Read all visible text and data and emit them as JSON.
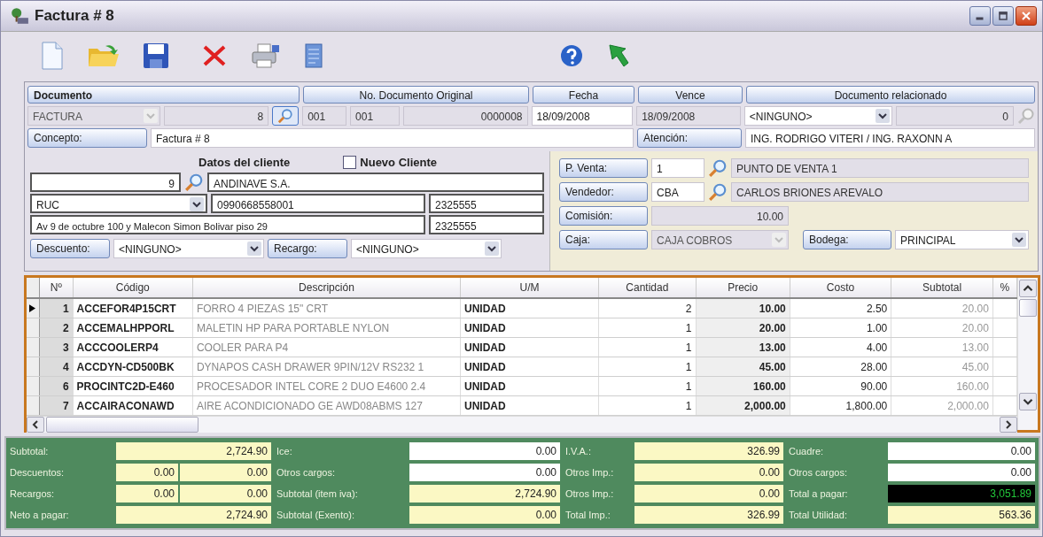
{
  "window": {
    "title": "Factura # 8"
  },
  "documento": {
    "headers": [
      "Documento",
      "No. Documento Original",
      "Fecha",
      "Vence",
      "Documento relacionado"
    ],
    "tipo": {
      "value": "FACTURA",
      "disabled": true
    },
    "numero": {
      "value": "8",
      "readonly": true
    },
    "serie_1": {
      "value": "001",
      "readonly": true
    },
    "serie_2": {
      "value": "001",
      "readonly": true
    },
    "secuencial": {
      "value": "0000008",
      "readonly": true
    },
    "fecha": {
      "value": "18/09/2008",
      "readonly": false
    },
    "vence": {
      "value": "18/09/2008",
      "readonly": true
    },
    "relacionado": {
      "value": "<NINGUNO>",
      "disabled": false
    },
    "relacionado_numero": {
      "value": "0",
      "readonly": true
    },
    "concepto": {
      "label": "Concepto:",
      "value": "Factura # 8"
    },
    "atencion": {
      "label": "Atención:",
      "value": "ING. RODRIGO VITERI / ING. RAXONN A"
    }
  },
  "cliente": {
    "title": "Datos del cliente",
    "nuevo": {
      "label": "Nuevo Cliente",
      "checked": false
    },
    "codigo": "9",
    "nombre": "ANDINAVE S.A.",
    "tipo_id": "RUC",
    "identificacion": "0990668558001",
    "telefono": "2325555",
    "direccion": "Av 9 de octubre 100 y Malecon Simon Bolivar piso 29",
    "telefono_2": "2325555",
    "descuento": {
      "label": "Descuento:",
      "value": "<NINGUNO>"
    },
    "recargo": {
      "label": "Recargo:",
      "value": "<NINGUNO>"
    }
  },
  "venta": {
    "punto": {
      "label": "P. Venta:",
      "code": "1",
      "name": "PUNTO DE VENTA 1"
    },
    "vendedor": {
      "label": "Vendedor:",
      "code": "CBA",
      "name": "CARLOS BRIONES AREVALO"
    },
    "comision": {
      "label": "Comisión:",
      "value": "10.00"
    },
    "caja": {
      "label": "Caja:",
      "value": "CAJA COBROS",
      "disabled": true
    },
    "bodega": {
      "label": "Bodega:",
      "value": "PRINCIPAL",
      "disabled": false
    }
  },
  "table": {
    "columns": [
      "Nº",
      "Código",
      "Descripción",
      "U/M",
      "Cantidad",
      "Precio",
      "Costo",
      "Subtotal",
      "%"
    ],
    "rows": [
      {
        "selected": true,
        "cells": [
          "1",
          "ACCEFOR4P15CRT",
          "FORRO 4 PIEZAS 15\" CRT",
          "UNIDAD",
          "2",
          "10.00",
          "2.50",
          "20.00"
        ]
      },
      {
        "selected": false,
        "cells": [
          "2",
          "ACCEMALHPPORL",
          "MALETIN HP PARA PORTABLE NYLON",
          "UNIDAD",
          "1",
          "20.00",
          "1.00",
          "20.00"
        ]
      },
      {
        "selected": false,
        "cells": [
          "3",
          "ACCCOOLERP4",
          "COOLER PARA P4",
          "UNIDAD",
          "1",
          "13.00",
          "4.00",
          "13.00"
        ]
      },
      {
        "selected": false,
        "cells": [
          "4",
          "ACCDYN-CD500BK",
          "DYNAPOS CASH DRAWER 9PIN/12V RS232 1",
          "UNIDAD",
          "1",
          "45.00",
          "28.00",
          "45.00"
        ]
      },
      {
        "selected": false,
        "cells": [
          "6",
          "PROCINTC2D-E460",
          "PROCESADOR INTEL CORE 2 DUO E4600  2.4",
          "UNIDAD",
          "1",
          "160.00",
          "90.00",
          "160.00"
        ]
      },
      {
        "selected": false,
        "cells": [
          "7",
          "ACCAIRACONAWD",
          "AIRE ACONDICIONADO GE AWD08ABMS 127",
          "UNIDAD",
          "1",
          "2,000.00",
          "1,800.00",
          "2,000.00"
        ]
      }
    ]
  },
  "totals": {
    "columns": [
      [
        {
          "label": "Subtotal:",
          "kind": "computed",
          "values": [
            "2,724.90"
          ]
        },
        {
          "label": "Descuentos:",
          "kind": "computed",
          "values": [
            "0.00",
            "0.00"
          ]
        },
        {
          "label": "Recargos:",
          "kind": "computed",
          "values": [
            "0.00",
            "0.00"
          ]
        },
        {
          "label": "Neto a pagar:",
          "kind": "computed",
          "values": [
            "2,724.90"
          ]
        }
      ],
      [
        {
          "label": "Ice:",
          "kind": "editable",
          "values": [
            "0.00"
          ]
        },
        {
          "label": "Otros cargos:",
          "kind": "editable",
          "values": [
            "0.00"
          ]
        },
        {
          "label": "Subtotal (item iva):",
          "kind": "computed",
          "values": [
            "2,724.90"
          ]
        },
        {
          "label": "Subtotal (Exento):",
          "kind": "computed",
          "values": [
            "0.00"
          ]
        }
      ],
      [
        {
          "label": "I.V.A.:",
          "kind": "computed",
          "values": [
            "326.99"
          ]
        },
        {
          "label": "Otros Imp.:",
          "kind": "computed",
          "values": [
            "0.00"
          ]
        },
        {
          "label": "Otros Imp.:",
          "kind": "computed",
          "values": [
            "0.00"
          ]
        },
        {
          "label": "Total Imp.:",
          "kind": "computed",
          "values": [
            "326.99"
          ]
        }
      ],
      [
        {
          "label": "Cuadre:",
          "kind": "editable",
          "values": [
            "0.00"
          ]
        },
        {
          "label": "Otros cargos:",
          "kind": "editable",
          "values": [
            "0.00"
          ]
        },
        {
          "label": "Total a pagar:",
          "kind": "grand_total",
          "values": [
            "3,051.89"
          ]
        },
        {
          "label": "Total Utilidad:",
          "kind": "computed",
          "values": [
            "563.36"
          ]
        }
      ]
    ]
  }
}
